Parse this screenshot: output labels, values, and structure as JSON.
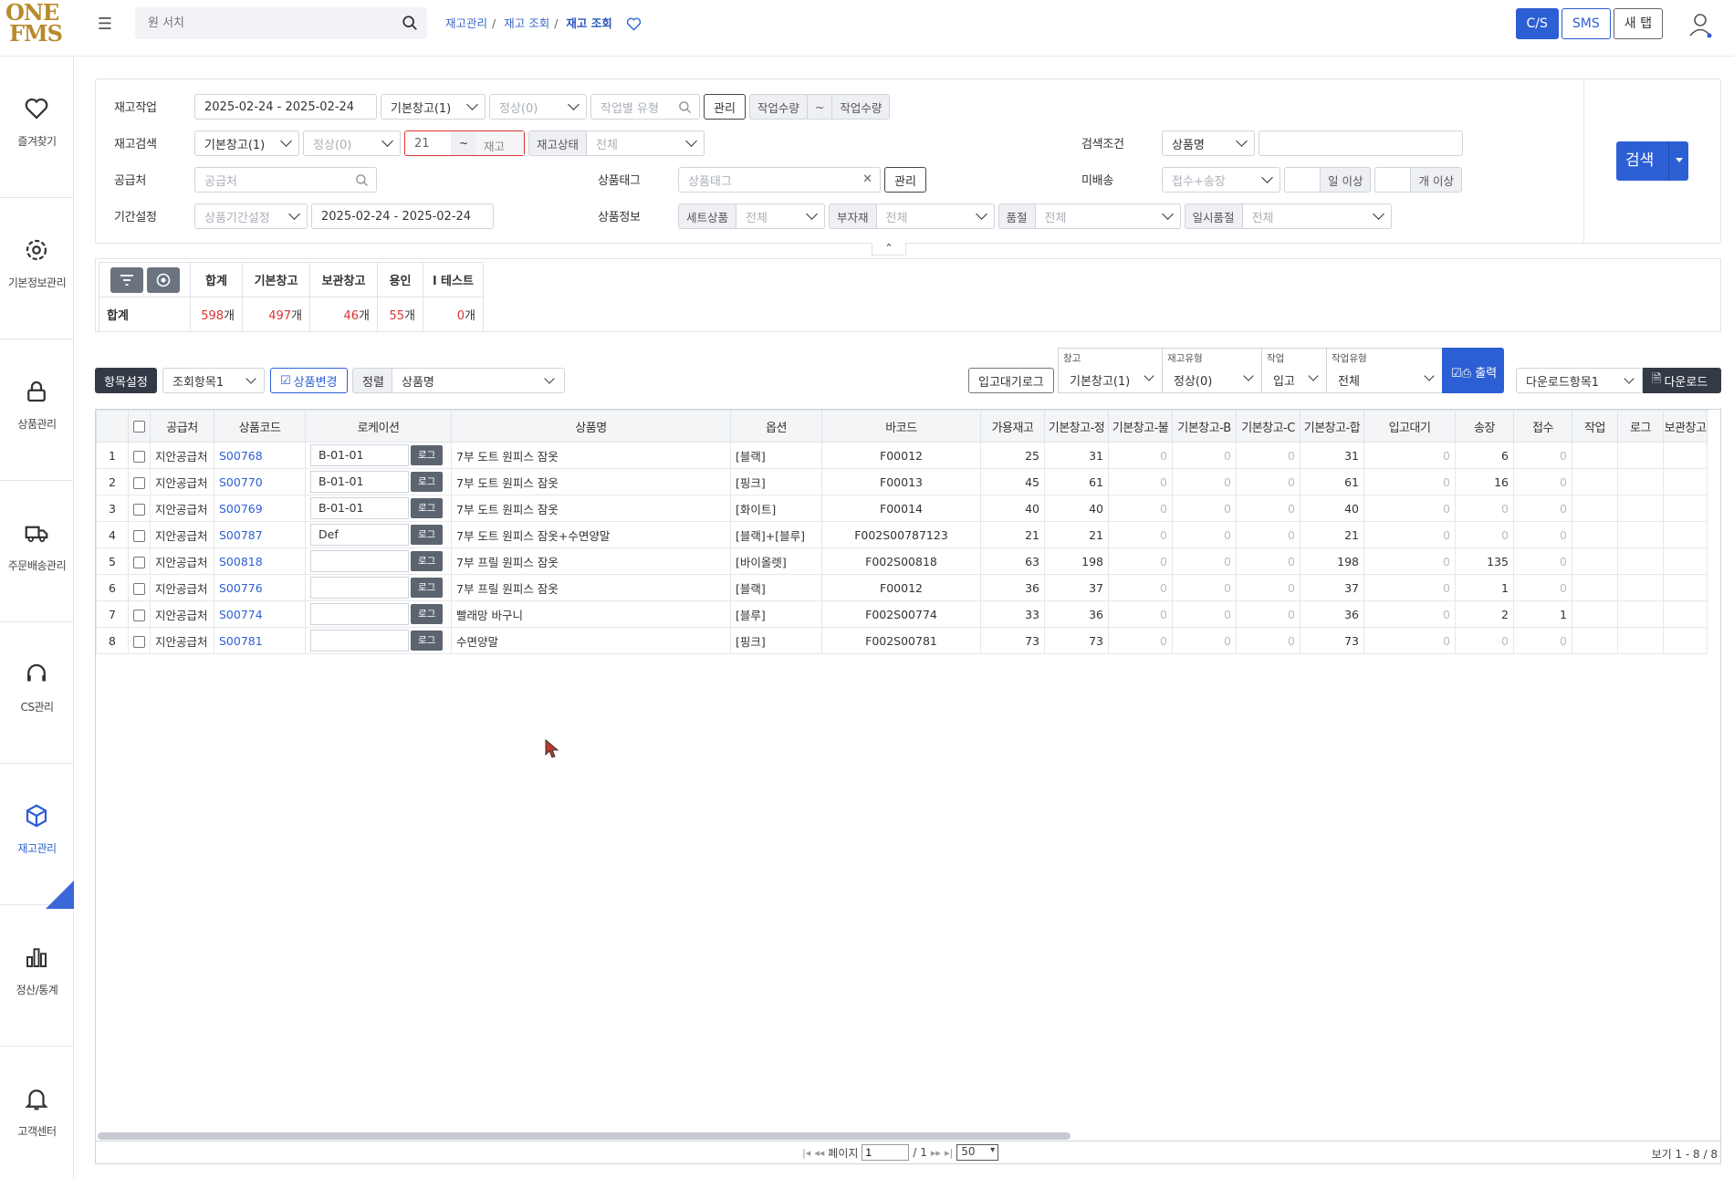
{
  "logo": {
    "line1": "ONE",
    "line2": "FMS"
  },
  "search": {
    "placeholder": "원 서치"
  },
  "breadcrumb": {
    "items": [
      "재고관리",
      "재고 조회",
      "재고 조회"
    ]
  },
  "topbar": {
    "cs": "C/S",
    "sms": "SMS",
    "newtab": "새 탭"
  },
  "sidebar": {
    "items": [
      {
        "label": "즐겨찾기"
      },
      {
        "label": "기본정보관리"
      },
      {
        "label": "상품관리"
      },
      {
        "label": "주문배송관리"
      },
      {
        "label": "CS관리"
      },
      {
        "label": "재고관리"
      },
      {
        "label": "정산/통계"
      },
      {
        "label": "고객센터"
      }
    ]
  },
  "filter": {
    "labels": {
      "work": "재고작업",
      "stocksearch": "재고검색",
      "supplier": "공급처",
      "period": "기간설정",
      "searchcond": "검색조건",
      "tag": "상품태그",
      "unshipped": "미배송",
      "productinfo": "상품정보"
    },
    "row1": {
      "date": "2025-02-24 - 2025-02-24",
      "warehouse": "기본창고(1)",
      "status": "정상(0)",
      "worktype": "작업별 유형",
      "manage": "관리",
      "qty_from": "작업수량",
      "tilde": "~",
      "qty_to": "작업수량"
    },
    "row2": {
      "warehouse": "기본창고(1)",
      "status": "정상(0)",
      "stock_from": "21",
      "tilde": "~",
      "stock_to": "재고",
      "stockstatus_tag": "재고상태",
      "stockstatus": "전체",
      "cond": "상품명",
      "cond_value": ""
    },
    "row3": {
      "supplier": "공급처",
      "tag": "상품태그",
      "manage": "관리",
      "unshipped": "접수+송장",
      "days": "일 이상",
      "count": "개 이상"
    },
    "row4": {
      "periodtype": "상품기간설정",
      "date": "2025-02-24 - 2025-02-24",
      "set_tag": "세트상품",
      "set": "전체",
      "sub_tag": "부자재",
      "sub": "전체",
      "soldout_tag": "품절",
      "soldout": "전체",
      "tempsold_tag": "일시품절",
      "tempsold": "전체"
    },
    "search_btn": "검색"
  },
  "summary": {
    "headers": [
      "합계",
      "기본창고",
      "보관창고",
      "용인",
      "l 테스트"
    ],
    "row_label": "합계",
    "values": [
      "598",
      "497",
      "46",
      "55",
      "0"
    ],
    "unit": "개"
  },
  "toolbar": {
    "settings": "항목설정",
    "view": "조회항목1",
    "change": "상품변경",
    "sort_tag": "정렬",
    "sort": "상품명",
    "inlog": "입고대기로그",
    "g_wh_label": "창고",
    "g_wh": "기본창고(1)",
    "g_type_label": "재고유형",
    "g_type": "정상(0)",
    "g_work_label": "작업",
    "g_work": "입고",
    "g_wtype_label": "작업유형",
    "g_wtype": "전체",
    "print": "출력",
    "dlset": "다운로드항목1",
    "download": "다운로드"
  },
  "grid": {
    "headers": [
      "",
      "",
      "공급처",
      "상품코드",
      "로케이션",
      "상품명",
      "옵션",
      "바코드",
      "가용재고",
      "기본창고-정",
      "기본창고-불",
      "기본창고-B",
      "기본창고-C",
      "기본창고-합",
      "입고대기",
      "송장",
      "접수",
      "작업",
      "로그",
      "보관창고"
    ],
    "rows": [
      {
        "n": "1",
        "supplier": "지안공급처",
        "code": "S00768",
        "loc": "B-01-01",
        "name": "7부 도트 원피스 잠옷",
        "opt": "[블랙]",
        "barcode": "F00012",
        "avail": "25",
        "a": "31",
        "b": "0",
        "c": "0",
        "d": "0",
        "sum": "31",
        "wait": "0",
        "inv": "6",
        "recv": "0"
      },
      {
        "n": "2",
        "supplier": "지안공급처",
        "code": "S00770",
        "loc": "B-01-01",
        "name": "7부 도트 원피스 잠옷",
        "opt": "[핑크]",
        "barcode": "F00013",
        "avail": "45",
        "a": "61",
        "b": "0",
        "c": "0",
        "d": "0",
        "sum": "61",
        "wait": "0",
        "inv": "16",
        "recv": "0"
      },
      {
        "n": "3",
        "supplier": "지안공급처",
        "code": "S00769",
        "loc": "B-01-01",
        "name": "7부 도트 원피스 잠옷",
        "opt": "[화이트]",
        "barcode": "F00014",
        "avail": "40",
        "a": "40",
        "b": "0",
        "c": "0",
        "d": "0",
        "sum": "40",
        "wait": "0",
        "inv": "0",
        "recv": "0"
      },
      {
        "n": "4",
        "supplier": "지안공급처",
        "code": "S00787",
        "loc": "Def",
        "name": "7부 도트 원피스 잠옷+수면양말",
        "opt": "[블랙]+[블루]",
        "barcode": "F002S00787123",
        "avail": "21",
        "a": "21",
        "b": "0",
        "c": "0",
        "d": "0",
        "sum": "21",
        "wait": "0",
        "inv": "0",
        "recv": "0"
      },
      {
        "n": "5",
        "supplier": "지안공급처",
        "code": "S00818",
        "loc": "",
        "name": "7부 프릴 원피스 잠옷",
        "opt": "[바이올렛]",
        "barcode": "F002S00818",
        "avail": "63",
        "a": "198",
        "b": "0",
        "c": "0",
        "d": "0",
        "sum": "198",
        "wait": "0",
        "inv": "135",
        "recv": "0"
      },
      {
        "n": "6",
        "supplier": "지안공급처",
        "code": "S00776",
        "loc": "",
        "name": "7부 프릴 원피스 잠옷",
        "opt": "[블랙]",
        "barcode": "F00012",
        "avail": "36",
        "a": "37",
        "b": "0",
        "c": "0",
        "d": "0",
        "sum": "37",
        "wait": "0",
        "inv": "1",
        "recv": "0"
      },
      {
        "n": "7",
        "supplier": "지안공급처",
        "code": "S00774",
        "loc": "",
        "name": "빨래망 바구니",
        "opt": "[블루]",
        "barcode": "F002S00774",
        "avail": "33",
        "a": "36",
        "b": "0",
        "c": "0",
        "d": "0",
        "sum": "36",
        "wait": "0",
        "inv": "2",
        "recv": "1"
      },
      {
        "n": "8",
        "supplier": "지안공급처",
        "code": "S00781",
        "loc": "",
        "name": "수면양말",
        "opt": "[핑크]",
        "barcode": "F002S00781",
        "avail": "73",
        "a": "73",
        "b": "0",
        "c": "0",
        "d": "0",
        "sum": "73",
        "wait": "0",
        "inv": "0",
        "recv": "0"
      }
    ],
    "log_label": "로그"
  },
  "pager": {
    "page_label": "페이지",
    "page": "1",
    "total": "/ 1",
    "size": "50",
    "summary": "보기 1 - 8 / 8"
  }
}
